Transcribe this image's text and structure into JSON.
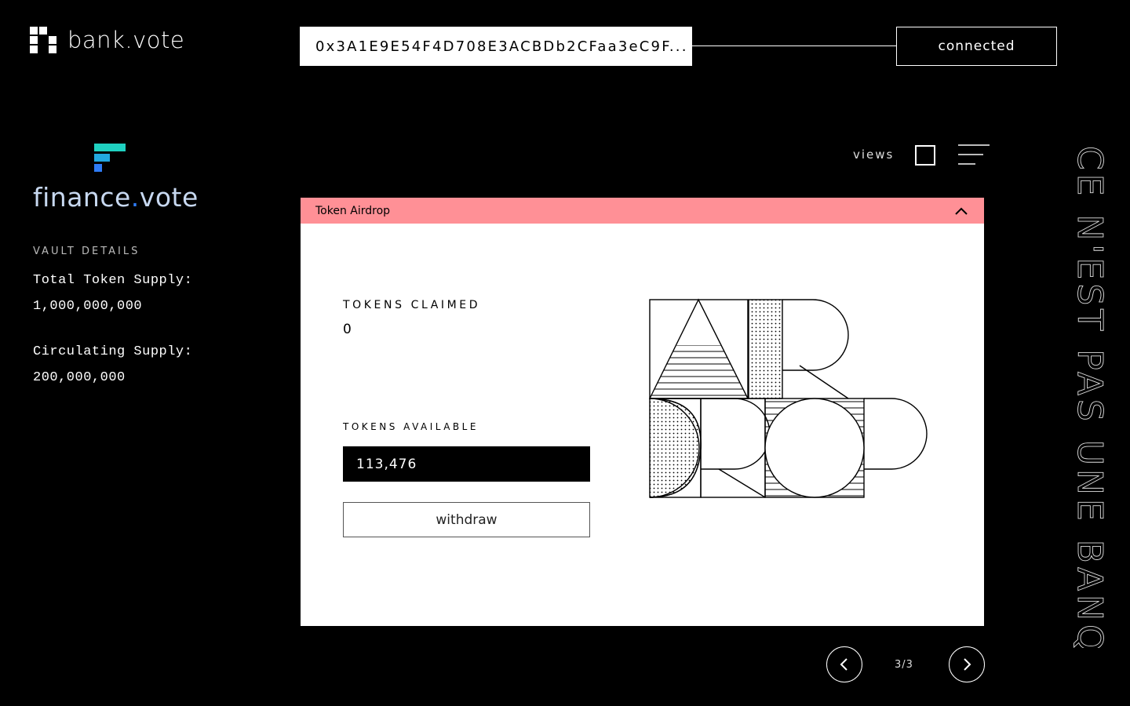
{
  "header": {
    "brand_name": "bank.vote",
    "wallet_address": "0x3A1E9E54F4D708E3ACBDb2CFaa3eC9F...",
    "connection_status": "connected"
  },
  "sidebar": {
    "project_name": "finance",
    "project_name_dot": ".",
    "project_name_suffix": "vote",
    "section_title": "VAULT DETAILS",
    "total_supply_label": "Total Token Supply:",
    "total_supply_value": "1,000,000,000",
    "circulating_supply_label": "Circulating Supply:",
    "circulating_supply_value": "200,000,000",
    "logo_colors": [
      "#1fd1c1",
      "#2e7cf6"
    ]
  },
  "views": {
    "label": "views",
    "options": [
      "grid-view-icon",
      "list-view-icon"
    ]
  },
  "card": {
    "title": "Token Airdrop",
    "header_color": "#ff9096",
    "tokens_claimed_label": "TOKENS CLAIMED",
    "tokens_claimed_value": "0",
    "tokens_available_label": "TOKENS AVAILABLE",
    "tokens_available_value": "113,476",
    "withdraw_label": "withdraw",
    "artwork_lettering": "AIRDROP"
  },
  "pagination": {
    "indicator": "3/3"
  },
  "slogan": "CE N'EST PAS UNE BANQUE"
}
